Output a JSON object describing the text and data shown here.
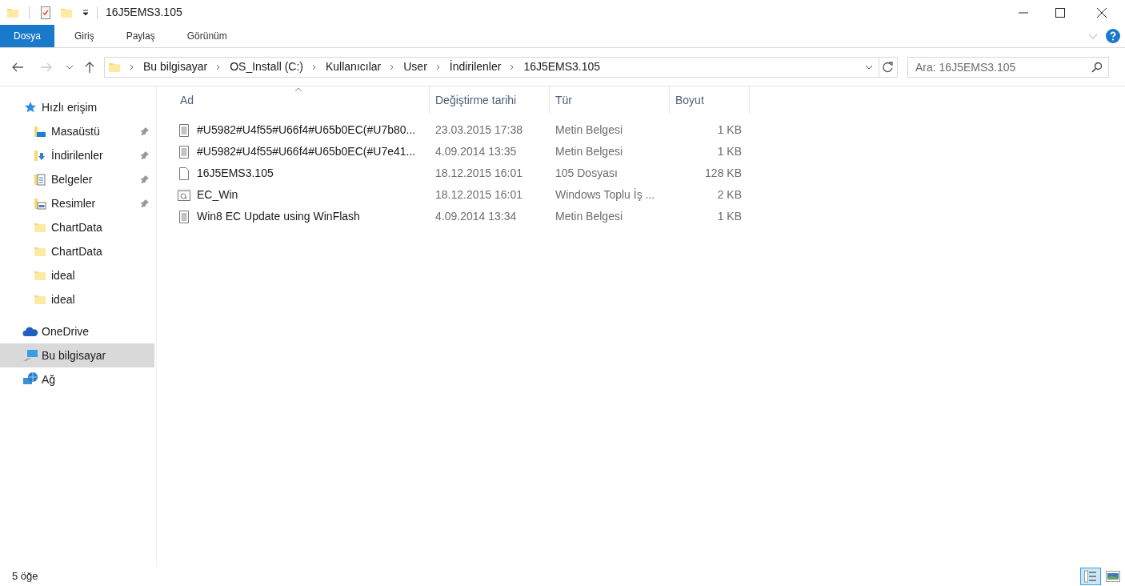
{
  "window": {
    "title": "16J5EMS3.105"
  },
  "ribbon_tabs": [
    {
      "label": "Dosya",
      "selected": true
    },
    {
      "label": "Giriş",
      "selected": false
    },
    {
      "label": "Paylaş",
      "selected": false
    },
    {
      "label": "Görünüm",
      "selected": false
    }
  ],
  "breadcrumb": [
    "Bu bilgisayar",
    "OS_Install (C:)",
    "Kullanıcılar",
    "User",
    "İndirilenler",
    "16J5EMS3.105"
  ],
  "search": {
    "placeholder": "Ara: 16J5EMS3.105"
  },
  "sidebar": {
    "items": [
      {
        "label": "Hızlı erişim",
        "kind": "quick",
        "selected": false,
        "children": [
          {
            "label": "Masaüstü",
            "kind": "desktop",
            "pinned": true,
            "selected": false
          },
          {
            "label": "İndirilenler",
            "kind": "downloads",
            "pinned": true,
            "selected": false
          },
          {
            "label": "Belgeler",
            "kind": "documents",
            "pinned": true,
            "selected": false
          },
          {
            "label": "Resimler",
            "kind": "pictures",
            "pinned": true,
            "selected": false
          },
          {
            "label": "ChartData",
            "kind": "folder",
            "pinned": false,
            "selected": false
          },
          {
            "label": "ChartData",
            "kind": "folder",
            "pinned": false,
            "selected": false
          },
          {
            "label": "ideal",
            "kind": "folder",
            "pinned": false,
            "selected": false
          },
          {
            "label": "ideal",
            "kind": "folder",
            "pinned": false,
            "selected": false
          }
        ]
      },
      {
        "label": "OneDrive",
        "kind": "cloud",
        "selected": false
      },
      {
        "label": "Bu bilgisayar",
        "kind": "pc",
        "selected": true
      },
      {
        "label": "Ağ",
        "kind": "network",
        "selected": false
      }
    ]
  },
  "table": {
    "columns": [
      "Ad",
      "Değiştirme tarihi",
      "Tür",
      "Boyut"
    ],
    "rows": [
      {
        "name": "#U5982#U4f55#U66f4#U65b0EC(#U7b80...",
        "date": "23.03.2015 17:38",
        "type": "Metin Belgesi",
        "size": "1 KB",
        "kind": "text"
      },
      {
        "name": "#U5982#U4f55#U66f4#U65b0EC(#U7e41...",
        "date": "4.09.2014 13:35",
        "type": "Metin Belgesi",
        "size": "1 KB",
        "kind": "text"
      },
      {
        "name": "16J5EMS3.105",
        "date": "18.12.2015 16:01",
        "type": "105 Dosyası",
        "size": "128 KB",
        "kind": "blank"
      },
      {
        "name": "EC_Win",
        "date": "18.12.2015 16:01",
        "type": "Windows Toplu İş ...",
        "size": "2 KB",
        "kind": "batch"
      },
      {
        "name": "Win8 EC Update using WinFlash",
        "date": "4.09.2014 13:34",
        "type": "Metin Belgesi",
        "size": "1 KB",
        "kind": "text"
      }
    ]
  },
  "status_bar": {
    "count": "5 öğe"
  },
  "views": [
    {
      "kind": "details",
      "selected": true
    },
    {
      "kind": "thumbnails",
      "selected": false
    }
  ]
}
